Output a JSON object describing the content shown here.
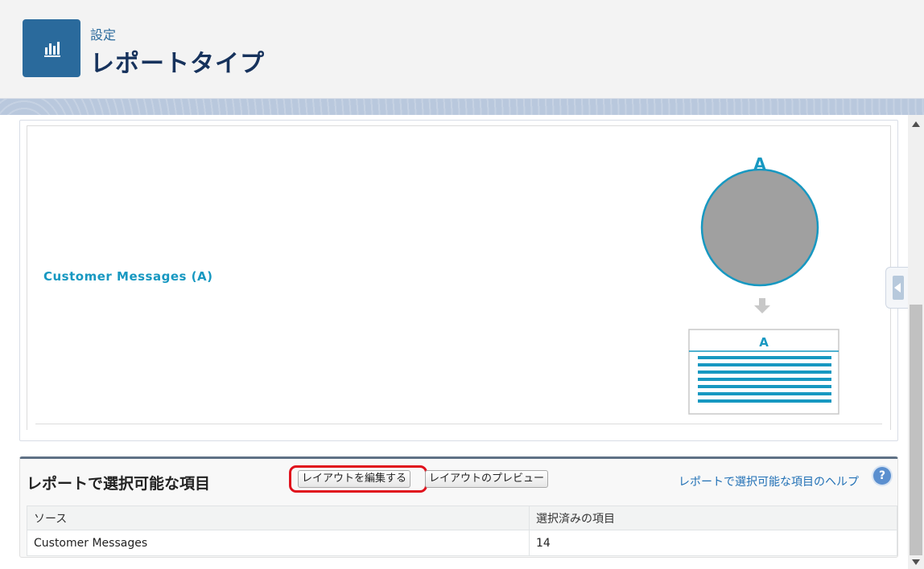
{
  "header": {
    "breadcrumb": "設定",
    "title": "レポートタイプ",
    "icon": "report-chart-icon"
  },
  "diagram": {
    "object_link": "Customer Messages (A)",
    "circle_label": "A",
    "table_label": "A",
    "colors": {
      "accent": "#1798c1",
      "circle_fill": "#a0a0a0"
    }
  },
  "fields_section": {
    "title": "レポートで選択可能な項目",
    "edit_layout_button": "レイアウトを編集する",
    "preview_layout_button": "レイアウトのプレビュー",
    "help_link": "レポートで選択可能な項目のヘルプ",
    "help_icon": "?",
    "columns": [
      "ソース",
      "選択済みの項目"
    ],
    "rows": [
      {
        "source": "Customer Messages",
        "selected": "14"
      }
    ],
    "highlight_color": "#e0101c"
  }
}
